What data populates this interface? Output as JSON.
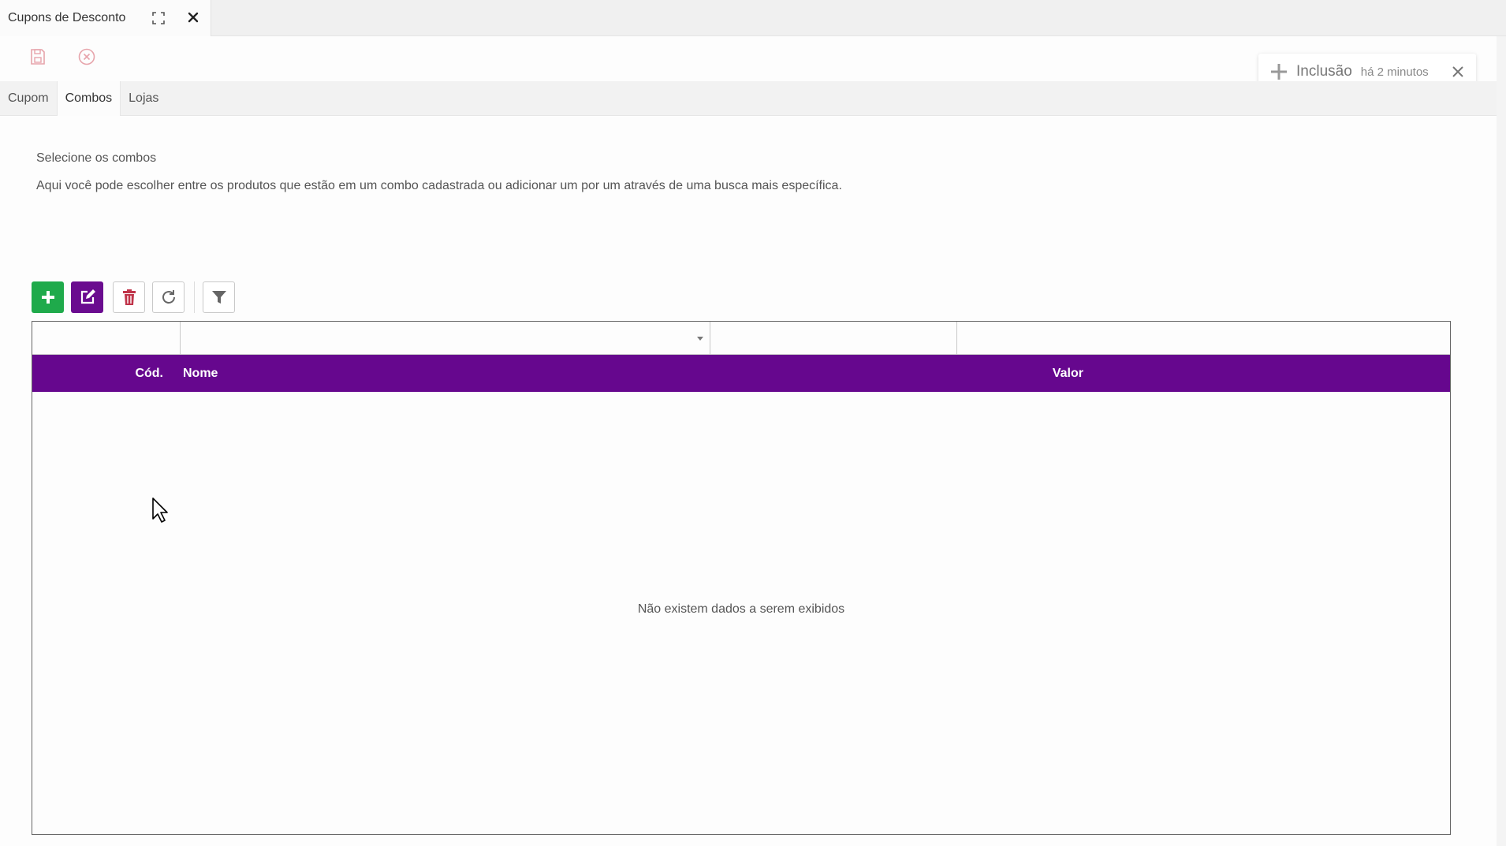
{
  "window": {
    "tab_title": "Cupons de Desconto",
    "expand_icon": "expand-icon",
    "close_icon": "close-icon"
  },
  "actions": {
    "save_icon": "save-icon",
    "cancel_icon": "cancel-circle-icon"
  },
  "notification": {
    "title": "Inclusão",
    "time": "há 2 minutos",
    "icon": "plus-icon"
  },
  "tabs": [
    {
      "label": "Cupom",
      "active": false
    },
    {
      "label": "Combos",
      "active": true
    },
    {
      "label": "Lojas",
      "active": false
    }
  ],
  "section": {
    "title": "Selecione os combos",
    "description": "Aqui você pode escolher entre os produtos que estão em um combo cadastrada ou adicionar um por um através de uma busca mais específica."
  },
  "grid_toolbar": {
    "add_icon": "plus-icon",
    "edit_icon": "edit-icon",
    "delete_icon": "trash-icon",
    "refresh_icon": "refresh-icon",
    "filter_icon": "filter-icon"
  },
  "grid": {
    "columns": [
      "Cód.",
      "Nome",
      "Valor"
    ],
    "filters": {
      "cod": "",
      "nome": "",
      "valor": "",
      "extra": ""
    },
    "empty_text": "Não existem dados a serem exibidos"
  },
  "colors": {
    "header_bg": "#66078e",
    "add_button": "#1faa4b",
    "edit_button": "#6a0b8f",
    "delete_icon": "#c0344a"
  }
}
